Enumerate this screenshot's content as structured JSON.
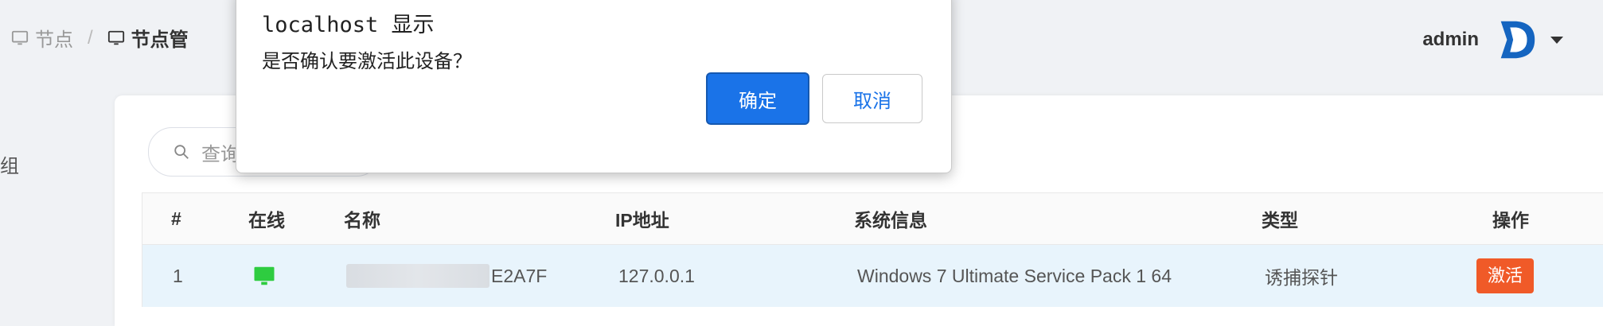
{
  "breadcrumb": {
    "items": [
      {
        "label": "节点",
        "icon": "monitor-icon"
      },
      {
        "label": "节点管",
        "icon": "monitor-icon"
      }
    ],
    "separator": "/"
  },
  "user": {
    "name": "admin",
    "avatar_letter": "D"
  },
  "sidebar": {
    "item_label": "组"
  },
  "search": {
    "placeholder": "查询"
  },
  "table": {
    "headers": [
      "#",
      "在线",
      "名称",
      "IP地址",
      "系统信息",
      "类型",
      "操作"
    ],
    "rows": [
      {
        "index": "1",
        "online_icon": "monitor-icon",
        "name_visible": "E2A7F",
        "ip": "127.0.0.1",
        "os": "Windows 7 Ultimate Service Pack 1 64",
        "type": "诱捕探针",
        "action": "激活"
      }
    ]
  },
  "dialog": {
    "title": "localhost 显示",
    "message": "是否确认要激活此设备？",
    "ok_label": "确定",
    "cancel_label": "取消"
  },
  "colors": {
    "primary": "#1a73e8",
    "danger": "#f05a28",
    "online": "#2ecc40",
    "row_highlight": "#e8f4fc",
    "avatar": "#1565c0"
  }
}
